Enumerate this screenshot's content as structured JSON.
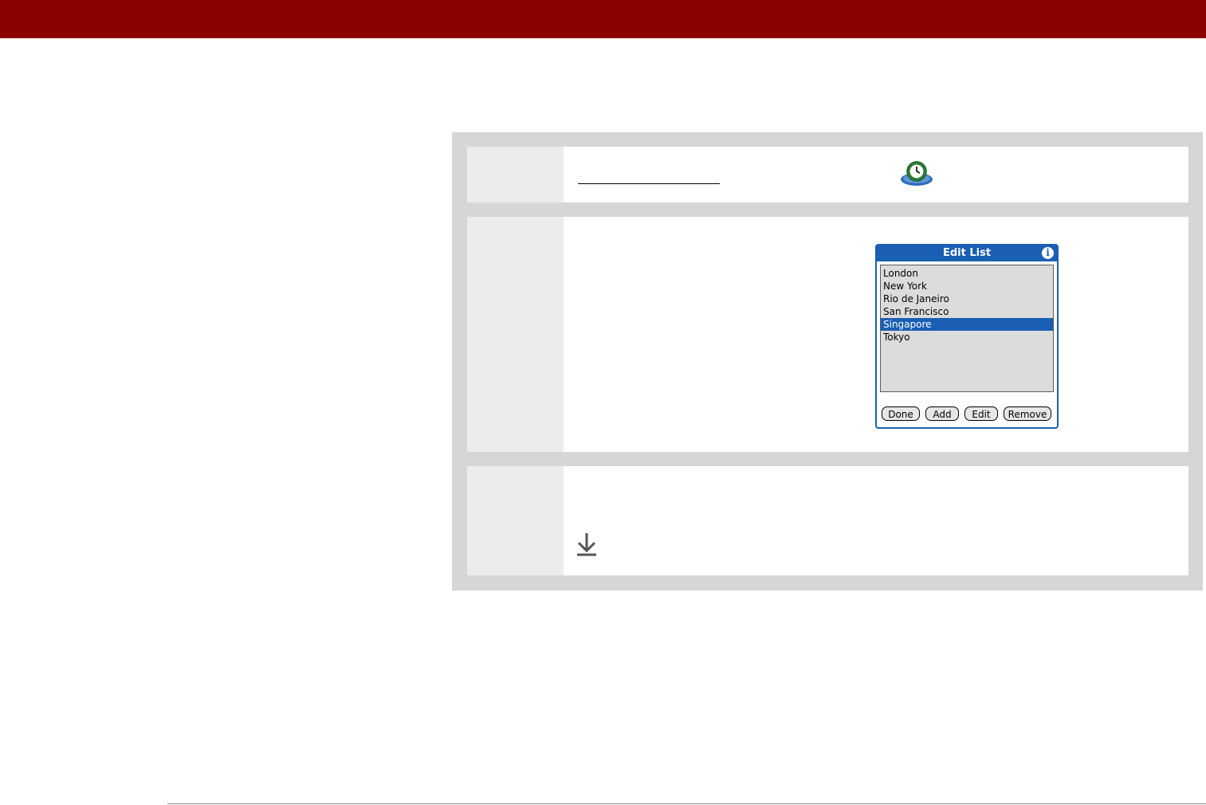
{
  "dialog": {
    "title": "Edit List",
    "info_glyph": "i",
    "items": [
      {
        "label": "London",
        "selected": false
      },
      {
        "label": "New York",
        "selected": false
      },
      {
        "label": "Rio de Janeiro",
        "selected": false
      },
      {
        "label": "San Francisco",
        "selected": false
      },
      {
        "label": "Singapore",
        "selected": true
      },
      {
        "label": "Tokyo",
        "selected": false
      }
    ],
    "buttons": {
      "done": "Done",
      "add": "Add",
      "edit": "Edit",
      "remove": "Remove"
    }
  },
  "icons": {
    "clock": "world-clock-icon",
    "arrow": "download-arrow-icon",
    "info": "info-icon"
  },
  "colors": {
    "header": "#8b0000",
    "panel": "#d6d6d6",
    "palm_blue": "#1a5fb4"
  }
}
